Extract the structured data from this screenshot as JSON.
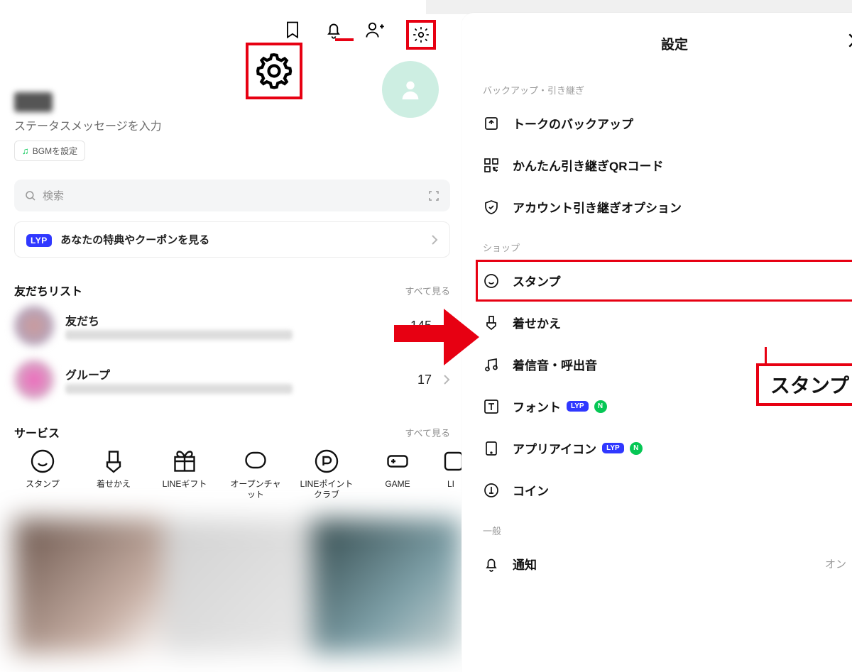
{
  "home": {
    "status_placeholder": "ステータスメッセージを入力",
    "bgm_label": "BGMを設定",
    "search_placeholder": "検索",
    "lyp_badge": "LYP",
    "lyp_text": "あなたの特典やクーポンを見る",
    "friends_header": "友だちリスト",
    "friends_seeall": "すべて見る",
    "friends": [
      {
        "name": "友だち",
        "count": "145"
      },
      {
        "name": "グループ",
        "count": "17"
      }
    ],
    "services_header": "サービス",
    "services_seeall": "すべて見る",
    "services": [
      {
        "label": "スタンプ"
      },
      {
        "label": "着せかえ"
      },
      {
        "label": "LINEギフト"
      },
      {
        "label": "オープンチャット"
      },
      {
        "label": "LINEポイントクラブ"
      },
      {
        "label": "GAME"
      },
      {
        "label": "LI"
      }
    ]
  },
  "settings": {
    "title": "設定",
    "section_backup": "バックアップ・引き継ぎ",
    "backup_items": [
      "トークのバックアップ",
      "かんたん引き継ぎQRコード",
      "アカウント引き継ぎオプション"
    ],
    "section_shop": "ショップ",
    "shop_items": [
      {
        "label": "スタンプ",
        "lyp": false,
        "new": false
      },
      {
        "label": "着せかえ",
        "lyp": false,
        "new": false
      },
      {
        "label": "着信音・呼出音",
        "lyp": false,
        "new": false
      },
      {
        "label": "フォント",
        "lyp": true,
        "new": true
      },
      {
        "label": "アプリアイコン",
        "lyp": true,
        "new": true
      },
      {
        "label": "コイン",
        "lyp": false,
        "new": false
      }
    ],
    "section_general": "一般",
    "general_items": [
      {
        "label": "通知",
        "value": "オン"
      }
    ]
  },
  "annotations": {
    "stamp_callout": "スタンプ",
    "lyp_mini": "LYP",
    "n_mini": "N"
  },
  "colors": {
    "accent_red": "#E70012"
  }
}
